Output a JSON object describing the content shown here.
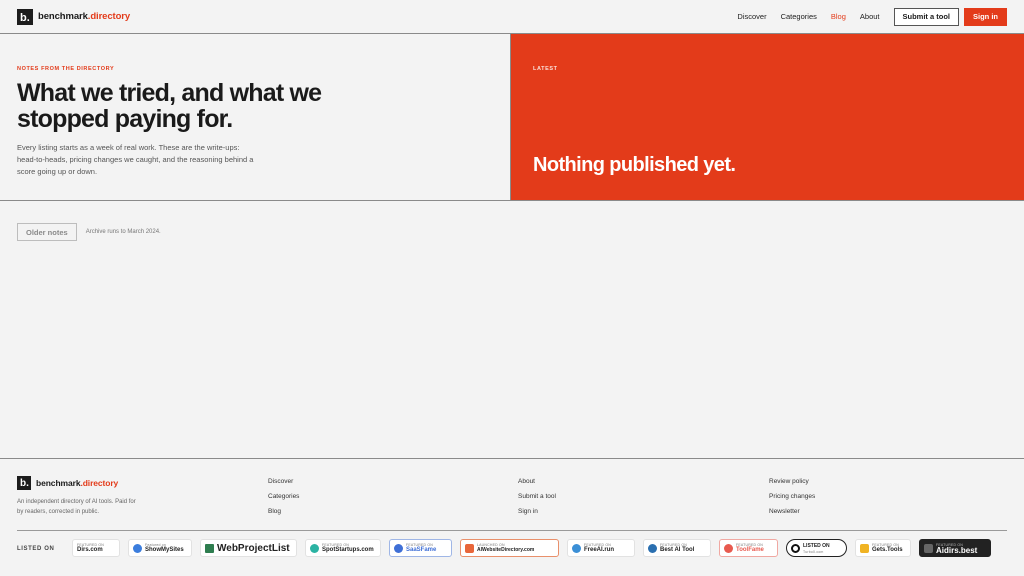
{
  "header": {
    "logo_letter": "b.",
    "brand_main": "benchmark",
    "brand_accent": ".directory",
    "nav": [
      "Discover",
      "Categories",
      "Blog",
      "About"
    ],
    "active_nav": "Blog",
    "submit_label": "Submit a tool",
    "signin_label": "Sign in"
  },
  "hero": {
    "eyebrow": "NOTES FROM THE DIRECTORY",
    "title": "What we tried, and what we stopped paying for.",
    "description": "Every listing starts as a week of real work. These are the write-ups: head-to-heads, pricing changes we caught, and the reasoning behind a score going up or down.",
    "latest_label": "LATEST",
    "latest_title": "Nothing published yet."
  },
  "archive": {
    "button_label": "Older notes",
    "note": "Archive runs to March 2024."
  },
  "footer": {
    "logo_letter": "b.",
    "brand_main": "benchmark",
    "brand_accent": ".directory",
    "description": "An independent directory of AI tools. Paid for by readers, corrected in public.",
    "col1": [
      "Discover",
      "Categories",
      "Blog"
    ],
    "col2": [
      "About",
      "Submit a tool",
      "Sign in"
    ],
    "col3": [
      "Review policy",
      "Pricing changes",
      "Newsletter"
    ],
    "listed_label": "LISTED ON",
    "badges": [
      {
        "small": "FEATURED ON",
        "big": "Dirs.com",
        "icon_color": "#d0d0d0"
      },
      {
        "small": "Featured on",
        "big": "ShowMySites",
        "icon_color": "#3b7ddd"
      },
      {
        "small": "",
        "big": "WebProjectList",
        "icon_color": "#2e7d4f"
      },
      {
        "small": "FEATURED ON",
        "big": "SpotStartups.com",
        "icon_color": "#2bb3a3"
      },
      {
        "small": "FEATURED ON",
        "big": "SaaSFame",
        "icon_color": "#3f6fd6"
      },
      {
        "small": "LAUNCHED ON",
        "big": "AIWebsiteDirectory.com",
        "icon_color": "#e8663a"
      },
      {
        "small": "FEATURED ON",
        "big": "FreeAI.run",
        "icon_color": "#3b8fd6"
      },
      {
        "small": "FEATURED ON",
        "big": "Best AI Tool",
        "icon_color": "#2a6fb0"
      },
      {
        "small": "FEATURED ON",
        "big": "ToolFame",
        "icon_color": "#e85a4f"
      },
      {
        "small": "LISTED ON",
        "big": "Turbo0.com",
        "icon_color": "#111111"
      },
      {
        "small": "FEATURED ON",
        "big": "Gets.Tools",
        "icon_color": "#f0b323"
      },
      {
        "small": "FEATURED ON",
        "big": "Aidirs.best",
        "icon_color": "#444444"
      }
    ]
  },
  "colors": {
    "accent": "#e33b1a",
    "background": "#f3f3f3",
    "text": "#1a1a1a"
  }
}
